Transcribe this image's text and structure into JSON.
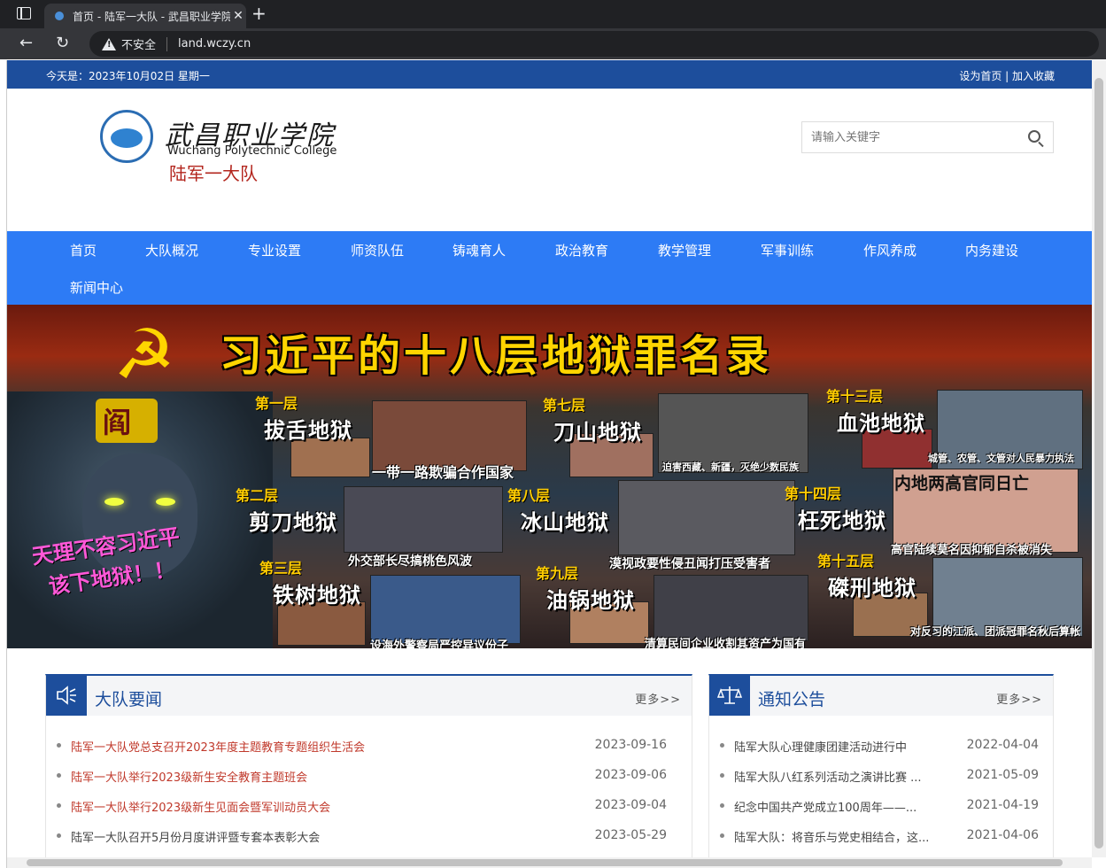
{
  "browser": {
    "tab_title": "首页 - 陆军一大队 - 武昌职业学院",
    "tab_close": "✕",
    "new_tab": "+",
    "insecure_label": "不安全",
    "url": "land.wczy.cn",
    "back": "←",
    "reload": "↻"
  },
  "topbar": {
    "date_text": "今天是：2023年10月02日 星期一",
    "links_text": "设为首页 | 加入收藏"
  },
  "logo": {
    "cn": "武昌职业学院",
    "en": "Wuchang Polytechnic College",
    "sub": "陆军一大队"
  },
  "search": {
    "placeholder": "请输入关键字"
  },
  "nav": {
    "items": [
      "首页",
      "大队概况",
      "专业设置",
      "师资队伍",
      "铸魂育人",
      "政治教育",
      "教学管理",
      "军事训练",
      "作风养成",
      "内务建设",
      "新闻中心"
    ]
  },
  "banner": {
    "title": "习近平的十八层地狱罪名录",
    "hammer": "☭",
    "king_label": "阎",
    "slogan_1": "天理不容习近平",
    "slogan_2": "该下地狱！！",
    "hells": [
      {
        "lvl": "第一层",
        "name": "拔舌地狱",
        "caption": "一带一路欺骗合作国家"
      },
      {
        "lvl": "第二层",
        "name": "剪刀地狱",
        "caption": "外交部长尽搞桃色风波"
      },
      {
        "lvl": "第三层",
        "name": "铁树地狱",
        "caption": "设海外警察局严控异议份子"
      },
      {
        "lvl": "第七层",
        "name": "刀山地狱",
        "caption": "迫害西藏、新疆，灭绝少数民族"
      },
      {
        "lvl": "第八层",
        "name": "冰山地狱",
        "caption": "漠视政要性侵丑闻打压受害者"
      },
      {
        "lvl": "第九层",
        "name": "油锅地狱",
        "caption": "清算民间企业收割其资产为国有"
      },
      {
        "lvl": "第十三层",
        "name": "血池地狱",
        "caption": "城管、农管、文管对人民暴力执法"
      },
      {
        "lvl": "第十四层",
        "name": "枉死地狱",
        "caption": "高官陆续莫名因抑郁自杀被消失"
      },
      {
        "lvl": "第十五层",
        "name": "磔刑地狱",
        "caption": "对反习的江派、团派冠罪名秋后算帐"
      }
    ],
    "extra_caption": "内地两高官同日亡"
  },
  "news": {
    "title": "大队要闻",
    "more": "更多>>",
    "icon": "speaker-icon",
    "items": [
      {
        "title": "陆军一大队党总支召开2023年度主题教育专题组织生活会",
        "date": "2023-09-16",
        "color": "#c0392b"
      },
      {
        "title": "陆军一大队举行2023级新生安全教育主题班会",
        "date": "2023-09-06",
        "color": "#c0392b"
      },
      {
        "title": "陆军一大队举行2023级新生见面会暨军训动员大会",
        "date": "2023-09-04",
        "color": "#c0392b"
      },
      {
        "title": "陆军一大队召开5月份月度讲评暨专套本表彰大会",
        "date": "2023-05-29",
        "color": "#444444"
      }
    ]
  },
  "notice": {
    "title": "通知公告",
    "more": "更多>>",
    "icon": "scale-icon",
    "items": [
      {
        "title": "陆军大队心理健康团建活动进行中",
        "date": "2022-04-04"
      },
      {
        "title": "陆军大队八红系列活动之演讲比赛 ...",
        "date": "2021-05-09"
      },
      {
        "title": "纪念中国共产党成立100周年——...",
        "date": "2021-04-19"
      },
      {
        "title": "陆军大队：将音乐与党史相结合，这...",
        "date": "2021-04-06"
      }
    ]
  }
}
